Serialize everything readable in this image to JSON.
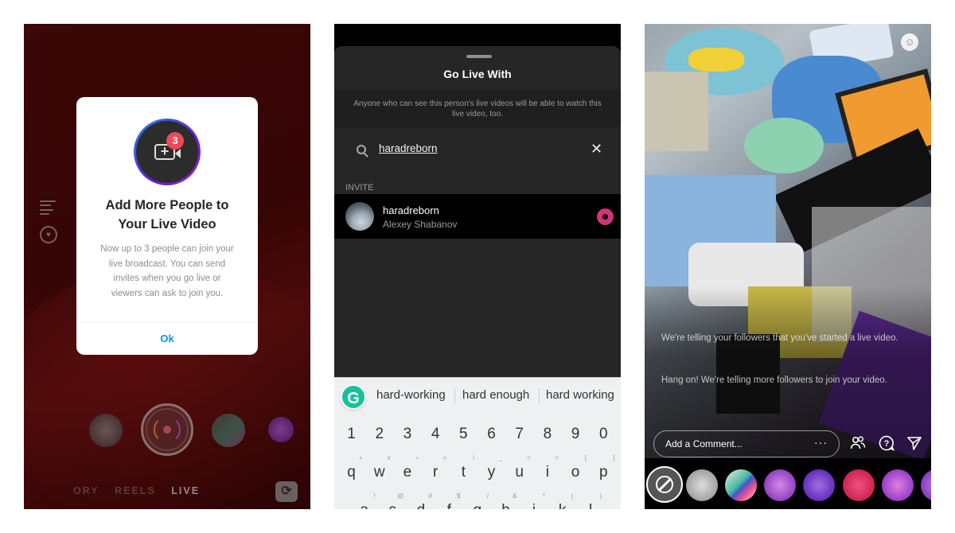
{
  "panel1": {
    "dialog": {
      "badge_count": "3",
      "title": "Add More People to Your Live Video",
      "body": "Now up to 3 people can join your live broadcast. You can send invites when you go live or viewers can ask to join you.",
      "ok_label": "Ok"
    },
    "modes": [
      "ORY",
      "REELS",
      "LIVE"
    ],
    "active_mode": "LIVE",
    "icons": {
      "menu": "menu-lines-icon",
      "heart_coin": "heart-coin-icon",
      "capture": "live-broadcast-icon",
      "flip": "camera-flip-icon"
    }
  },
  "panel2": {
    "sheet_title": "Go Live With",
    "note": "Anyone who can see this person's live videos will be able to watch this live video, too.",
    "search_value": "haradreborn",
    "clear_icon": "✕",
    "section_label": "INVITE",
    "users": [
      {
        "username": "haradreborn",
        "full_name": "Alexey Shabanov"
      }
    ],
    "keyboard": {
      "suggestions": [
        "hard-working",
        "hard enough",
        "hard working"
      ],
      "number_row": [
        "1",
        "2",
        "3",
        "4",
        "5",
        "6",
        "7",
        "8",
        "9",
        "0"
      ],
      "row1": [
        {
          "k": "q",
          "s": "+"
        },
        {
          "k": "w",
          "s": "x"
        },
        {
          "k": "e",
          "s": "÷"
        },
        {
          "k": "r",
          "s": "="
        },
        {
          "k": "t",
          "s": "/"
        },
        {
          "k": "y",
          "s": "_"
        },
        {
          "k": "u",
          "s": "<"
        },
        {
          "k": "i",
          "s": ">"
        },
        {
          "k": "o",
          "s": "["
        },
        {
          "k": "p",
          "s": "]"
        }
      ],
      "row2": [
        {
          "k": "a",
          "s": "!"
        },
        {
          "k": "s",
          "s": "@"
        },
        {
          "k": "d",
          "s": "#"
        },
        {
          "k": "f",
          "s": "$"
        },
        {
          "k": "g",
          "s": "/"
        },
        {
          "k": "h",
          "s": "&"
        },
        {
          "k": "j",
          "s": "*"
        },
        {
          "k": "k",
          "s": "("
        },
        {
          "k": "l",
          "s": ")"
        }
      ]
    }
  },
  "panel3": {
    "messages": [
      "We're telling your followers that you've started a live video.",
      "Hang on! We're telling more followers to join your video."
    ],
    "comment_placeholder": "Add a Comment...",
    "more_label": "···",
    "icons": {
      "face_effect": "face-sparkle-icon",
      "guests": "people-icon",
      "question": "question-bubble-icon",
      "share": "send-icon"
    }
  },
  "colors": {
    "instagram_blue": "#0095f6",
    "badge_red": "#ed4956",
    "invite_pink": "#e1306c",
    "grammarly_green": "#15c39a"
  }
}
